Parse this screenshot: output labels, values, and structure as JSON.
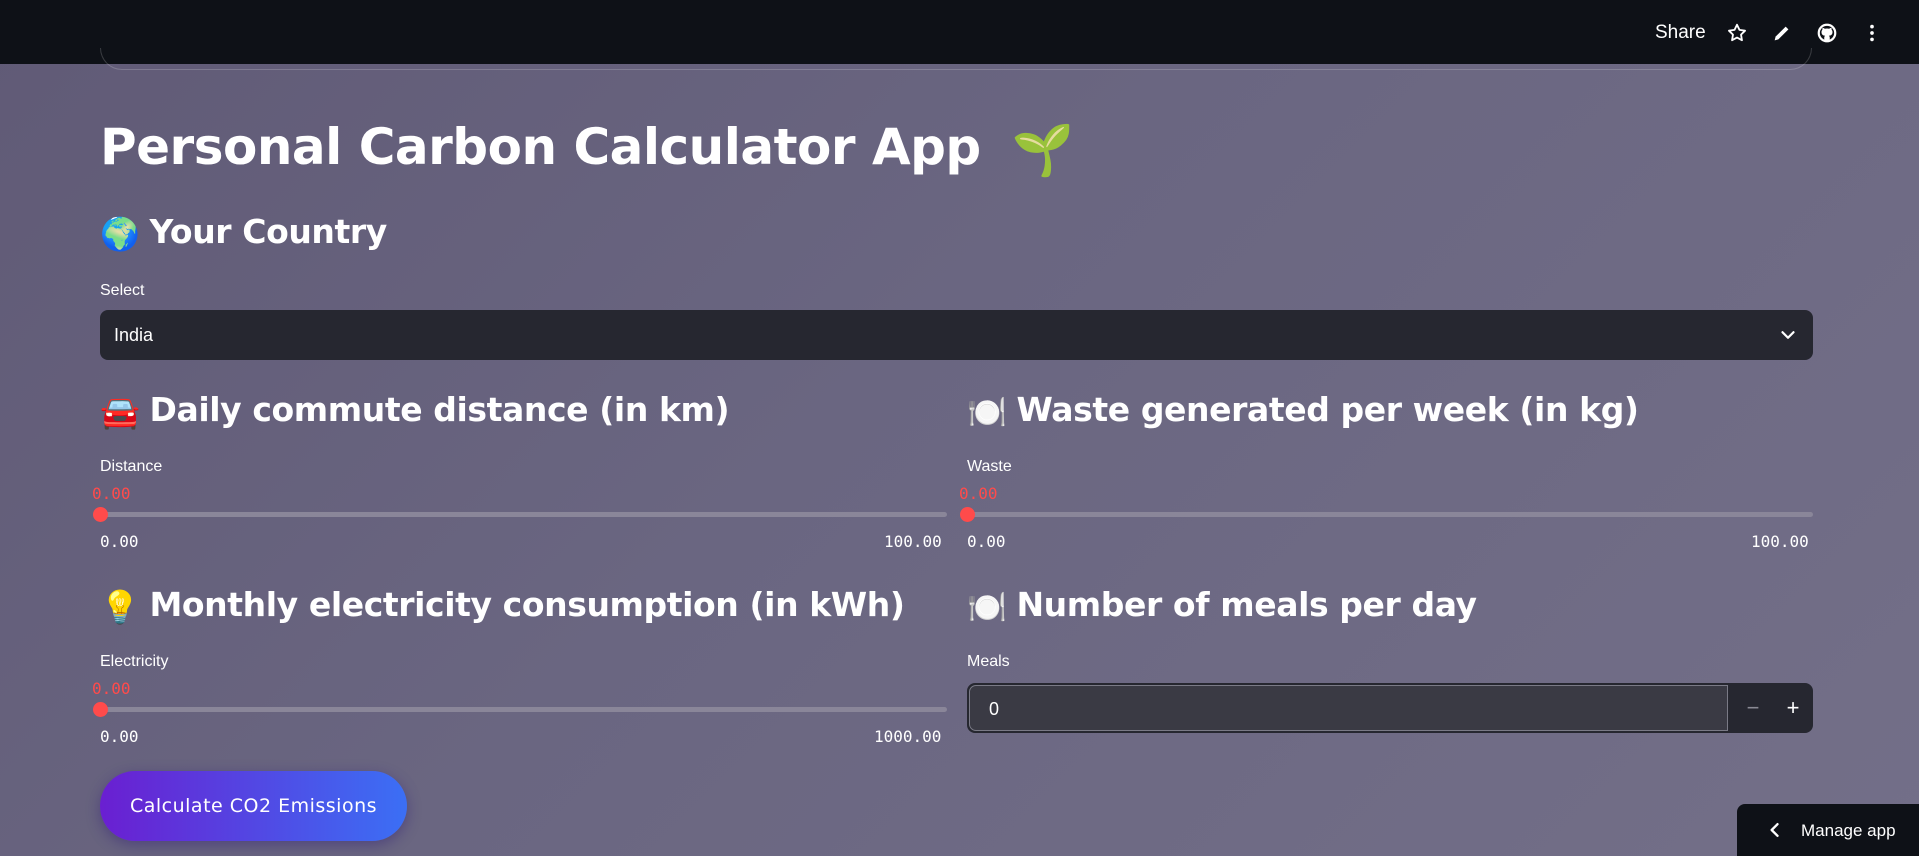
{
  "topbar": {
    "share_label": "Share",
    "icons": [
      "star-icon",
      "pencil-icon",
      "github-icon",
      "more-vertical-icon"
    ]
  },
  "title": {
    "text": "Personal Carbon Calculator App",
    "emoji": "🌱"
  },
  "country": {
    "heading": "Your Country",
    "emoji": "🌍",
    "select_label": "Select",
    "selected_value": "India"
  },
  "commute": {
    "heading": "Daily commute distance (in km)",
    "emoji": "🚘",
    "slider_label": "Distance",
    "value": "0.00",
    "min": "0.00",
    "max": "100.00",
    "fraction": 0
  },
  "waste": {
    "heading": "Waste generated per week (in kg)",
    "emoji": "🍽️",
    "slider_label": "Waste",
    "value": "0.00",
    "min": "0.00",
    "max": "100.00",
    "fraction": 0
  },
  "electricity": {
    "heading": "Monthly electricity consumption (in kWh)",
    "emoji": "💡",
    "slider_label": "Electricity",
    "value": "0.00",
    "min": "0.00",
    "max": "1000.00",
    "fraction": 0
  },
  "meals": {
    "heading": "Number of meals per day",
    "emoji": "🍽️",
    "input_label": "Meals",
    "value": "0",
    "minus": "−",
    "plus": "+"
  },
  "calculate_button": "Calculate CO2 Emissions",
  "manage_app": "Manage app",
  "colors": {
    "topbar": "#0e1117",
    "accent_red": "#ff4b4b",
    "input_bg": "#262730",
    "button_gradient_start": "#6a1fd1",
    "button_gradient_end": "#3b6ff5"
  }
}
